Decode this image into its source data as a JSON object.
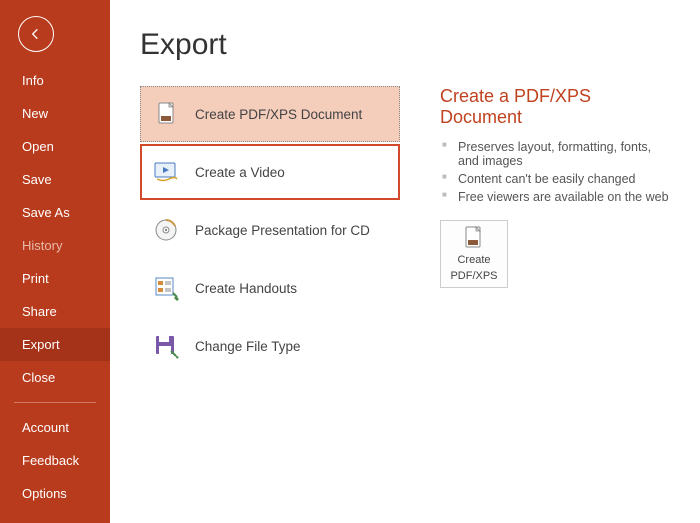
{
  "sidebar": {
    "items": [
      {
        "label": "Info"
      },
      {
        "label": "New"
      },
      {
        "label": "Open"
      },
      {
        "label": "Save"
      },
      {
        "label": "Save As"
      },
      {
        "label": "History"
      },
      {
        "label": "Print"
      },
      {
        "label": "Share"
      },
      {
        "label": "Export"
      },
      {
        "label": "Close"
      }
    ],
    "footer": [
      {
        "label": "Account"
      },
      {
        "label": "Feedback"
      },
      {
        "label": "Options"
      }
    ]
  },
  "page": {
    "title": "Export"
  },
  "options": [
    {
      "label": "Create PDF/XPS Document"
    },
    {
      "label": "Create a Video"
    },
    {
      "label": "Package Presentation for CD"
    },
    {
      "label": "Create Handouts"
    },
    {
      "label": "Change File Type"
    }
  ],
  "detail": {
    "title": "Create a PDF/XPS Document",
    "bullets": [
      "Preserves layout, formatting, fonts, and images",
      "Content can't be easily changed",
      "Free viewers are available on the web"
    ],
    "button_line1": "Create",
    "button_line2": "PDF/XPS"
  }
}
